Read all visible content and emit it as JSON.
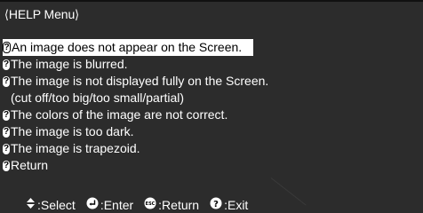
{
  "menu": {
    "title": "⟨HELP Menu⟩"
  },
  "items": [
    {
      "text": "An image does not appear on the Screen.",
      "selected": true
    },
    {
      "text": "The image is blurred."
    },
    {
      "text": "The image is not displayed fully on the Screen."
    },
    {
      "text": "(cut off/too big/too small/partial)"
    },
    {
      "text": "The colors of the image are not correct."
    },
    {
      "text": "The image is too dark."
    },
    {
      "text": "The image is trapezoid."
    },
    {
      "text": "Return"
    }
  ],
  "footer": {
    "select_label": ":Select",
    "enter_label": ":Enter",
    "return_label": ":Return",
    "exit_label": ":Exit",
    "select_icon": "up-down-arrow-icon",
    "enter_icon": "enter-icon",
    "return_icon": "esc-icon",
    "exit_icon": "help-icon"
  },
  "colors": {
    "background": "#2c2c2c",
    "text": "#ffffff",
    "highlight_background": "#ffffff",
    "highlight_text": "#000000"
  }
}
